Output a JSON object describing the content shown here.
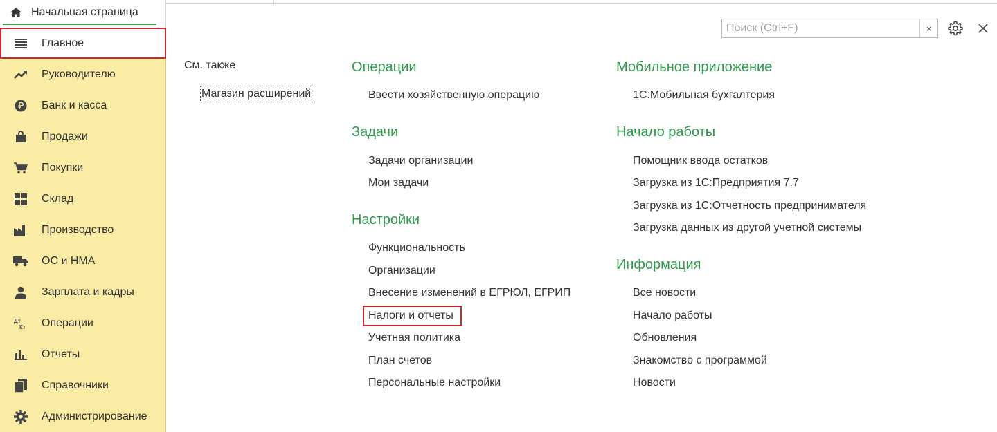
{
  "tabs": {
    "home_label": "Начальная страница"
  },
  "sidebar": {
    "items": [
      {
        "label": "Главное",
        "icon": "menu-lines-icon"
      },
      {
        "label": "Руководителю",
        "icon": "trend-icon"
      },
      {
        "label": "Банк и касса",
        "icon": "ruble-icon"
      },
      {
        "label": "Продажи",
        "icon": "shopping-bag-icon"
      },
      {
        "label": "Покупки",
        "icon": "cart-icon"
      },
      {
        "label": "Склад",
        "icon": "warehouse-grid-icon"
      },
      {
        "label": "Производство",
        "icon": "factory-icon"
      },
      {
        "label": "ОС и НМА",
        "icon": "truck-icon"
      },
      {
        "label": "Зарплата и кадры",
        "icon": "person-icon"
      },
      {
        "label": "Операции",
        "icon": "dt-kt-icon"
      },
      {
        "label": "Отчеты",
        "icon": "bar-chart-icon"
      },
      {
        "label": "Справочники",
        "icon": "books-icon"
      },
      {
        "label": "Администрирование",
        "icon": "gear-icon"
      }
    ]
  },
  "search": {
    "placeholder": "Поиск (Ctrl+F)",
    "value": "",
    "clear_label": "×"
  },
  "see_also": {
    "title": "См. также",
    "link": "Магазин расширений"
  },
  "sections": {
    "operations": {
      "title": "Операции",
      "links": [
        "Ввести хозяйственную операцию"
      ]
    },
    "tasks": {
      "title": "Задачи",
      "links": [
        "Задачи организации",
        "Мои задачи"
      ]
    },
    "settings": {
      "title": "Настройки",
      "links": [
        "Функциональность",
        "Организации",
        "Внесение изменений в ЕГРЮЛ, ЕГРИП",
        "Налоги и отчеты",
        "Учетная политика",
        "План счетов",
        "Персональные настройки"
      ]
    },
    "mobile": {
      "title": "Мобильное приложение",
      "links": [
        "1С:Мобильная бухгалтерия"
      ]
    },
    "start": {
      "title": "Начало работы",
      "links": [
        "Помощник ввода остатков",
        "Загрузка из 1С:Предприятия 7.7",
        "Загрузка из 1С:Отчетность предпринимателя",
        "Загрузка данных из другой учетной системы"
      ]
    },
    "info": {
      "title": "Информация",
      "links": [
        "Все новости",
        "Начало работы",
        "Обновления",
        "Знакомство с программой",
        "Новости"
      ]
    }
  },
  "colors": {
    "sidebar_bg": "#fbeca5",
    "accent_green": "#2e9a4c",
    "highlight_red": "#c8272d"
  }
}
